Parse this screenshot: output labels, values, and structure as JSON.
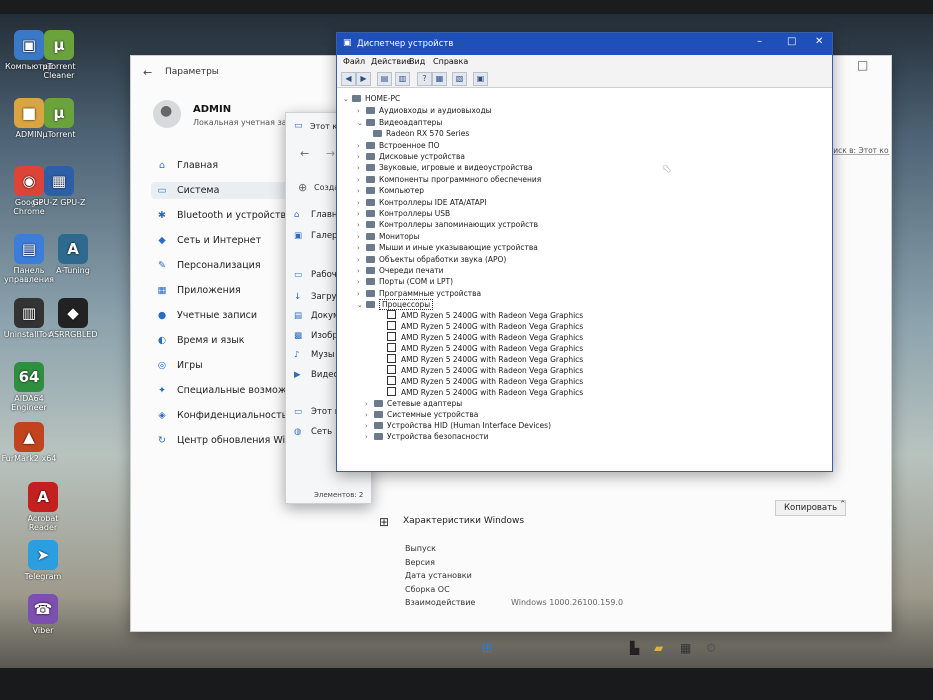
{
  "desktop": {
    "icons": [
      {
        "label": "Компьютер",
        "glyph": "▣",
        "color": "#3a78c8"
      },
      {
        "label": "µTorrent Cleaner",
        "glyph": "µ",
        "color": "#6aa33b"
      },
      {
        "label": "ADMIN",
        "glyph": "■",
        "color": "#d9a441"
      },
      {
        "label": "µTorrent",
        "glyph": "µ",
        "color": "#6aa33b"
      },
      {
        "label": "Google Chrome",
        "glyph": "◉",
        "color": "#db4437"
      },
      {
        "label": "GPU-Z GPU-Z",
        "glyph": "▦",
        "color": "#2c5fa8"
      },
      {
        "label": "Панель управления",
        "glyph": "▤",
        "color": "#3b7dd8"
      },
      {
        "label": "A-Tuning",
        "glyph": "A",
        "color": "#2d6a8e"
      },
      {
        "label": "UninstallTool",
        "glyph": "▥",
        "color": "#333333"
      },
      {
        "label": "ASRRGBLED",
        "glyph": "◆",
        "color": "#222222"
      },
      {
        "label": "AIDA64 Engineer",
        "glyph": "64",
        "color": "#2f8f3f"
      },
      {
        "label": "FurMark2 x64",
        "glyph": "▲",
        "color": "#c2441f"
      },
      {
        "label": "Acrobat Reader",
        "glyph": "A",
        "color": "#c4201f"
      },
      {
        "label": "Telegram",
        "glyph": "➤",
        "color": "#2b9ee0"
      },
      {
        "label": "Viber",
        "glyph": "☎",
        "color": "#7d4fb0"
      }
    ]
  },
  "settings": {
    "title": "Параметры",
    "user_name": "ADMIN",
    "user_sub": "Локальная учетная запи",
    "nav": [
      {
        "label": "Главная",
        "icon": "home-icon",
        "glyph": "⌂"
      },
      {
        "label": "Система",
        "icon": "system-icon",
        "glyph": "▭"
      },
      {
        "label": "Bluetooth и устройства",
        "icon": "bluetooth-icon",
        "glyph": "✱"
      },
      {
        "label": "Сеть и Интернет",
        "icon": "wifi-icon",
        "glyph": "◆"
      },
      {
        "label": "Персонализация",
        "icon": "brush-icon",
        "glyph": "✎"
      },
      {
        "label": "Приложения",
        "icon": "apps-icon",
        "glyph": "▦"
      },
      {
        "label": "Учетные записи",
        "icon": "user-icon",
        "glyph": "●"
      },
      {
        "label": "Время и язык",
        "icon": "globe-icon",
        "glyph": "◐"
      },
      {
        "label": "Игры",
        "icon": "gamepad-icon",
        "glyph": "◎"
      },
      {
        "label": "Специальные возможно",
        "icon": "accessibility-icon",
        "glyph": "✦"
      },
      {
        "label": "Конфиденциальность и з",
        "icon": "shield-icon",
        "glyph": "◈"
      },
      {
        "label": "Центр обновления Windo",
        "icon": "update-icon",
        "glyph": "↻"
      }
    ],
    "spec_title": "Характеристики Windows",
    "copy_button": "Копировать",
    "specs": [
      {
        "label": "Выпуск",
        "value": ""
      },
      {
        "label": "Версия",
        "value": ""
      },
      {
        "label": "Дата установки",
        "value": ""
      },
      {
        "label": "Сборка ОС",
        "value": ""
      },
      {
        "label": "Взаимодействие",
        "value": "Windows 1000.26100.159.0"
      }
    ],
    "search_placeholder": "Поиск в: Этот компьютер"
  },
  "explorer": {
    "tab_title": "Этот к",
    "new_button": "Создать",
    "items": [
      {
        "label": "Главн",
        "icon": "home-icon"
      },
      {
        "label": "Галер",
        "icon": "gallery-icon"
      },
      {
        "label": "Рабоч",
        "icon": "desktop-folder-icon"
      },
      {
        "label": "Загру",
        "icon": "downloads-icon"
      },
      {
        "label": "Докум",
        "icon": "documents-icon"
      },
      {
        "label": "Изобр",
        "icon": "pictures-icon"
      },
      {
        "label": "Музы",
        "icon": "music-icon"
      },
      {
        "label": "Видео",
        "icon": "videos-icon"
      },
      {
        "label": "Этот к",
        "icon": "computer-icon"
      },
      {
        "label": "Сеть",
        "icon": "network-icon"
      }
    ],
    "status": "Элементов: 2"
  },
  "device_manager": {
    "title": "Диспетчер устройств",
    "menu": [
      "Файл",
      "Действие",
      "Вид",
      "Справка"
    ],
    "root": "HOME-PC",
    "top_categories": [
      {
        "label": "Аудиовходы и аудиовыходы",
        "expanded": false
      },
      {
        "label": "Видеоадаптеры",
        "expanded": true
      }
    ],
    "video_children": [
      "Radeon RX 570 Series"
    ],
    "categories_after_video": [
      "Встроенное ПО",
      "Дисковые устройства",
      "Звуковые, игровые и видеоустройства",
      "Компоненты программного обеспечения",
      "Компьютер",
      "Контроллеры IDE ATA/ATAPI",
      "Контроллеры USB",
      "Контроллеры запоминающих устройств",
      "Мониторы",
      "Мыши и иные указывающие устройства",
      "Объекты обработки звука (APO)",
      "Очереди печати",
      "Порты (COM и LPT)",
      "Программные устройства"
    ],
    "processors_label": "Процессоры",
    "processors": [
      "AMD Ryzen 5 2400G with Radeon Vega Graphics",
      "AMD Ryzen 5 2400G with Radeon Vega Graphics",
      "AMD Ryzen 5 2400G with Radeon Vega Graphics",
      "AMD Ryzen 5 2400G with Radeon Vega Graphics",
      "AMD Ryzen 5 2400G with Radeon Vega Graphics",
      "AMD Ryzen 5 2400G with Radeon Vega Graphics",
      "AMD Ryzen 5 2400G with Radeon Vega Graphics",
      "AMD Ryzen 5 2400G with Radeon Vega Graphics"
    ],
    "categories_after_cpu": [
      "Сетевые адаптеры",
      "Системные устройства",
      "Устройства HID (Human Interface Devices)",
      "Устройства безопасности"
    ]
  }
}
